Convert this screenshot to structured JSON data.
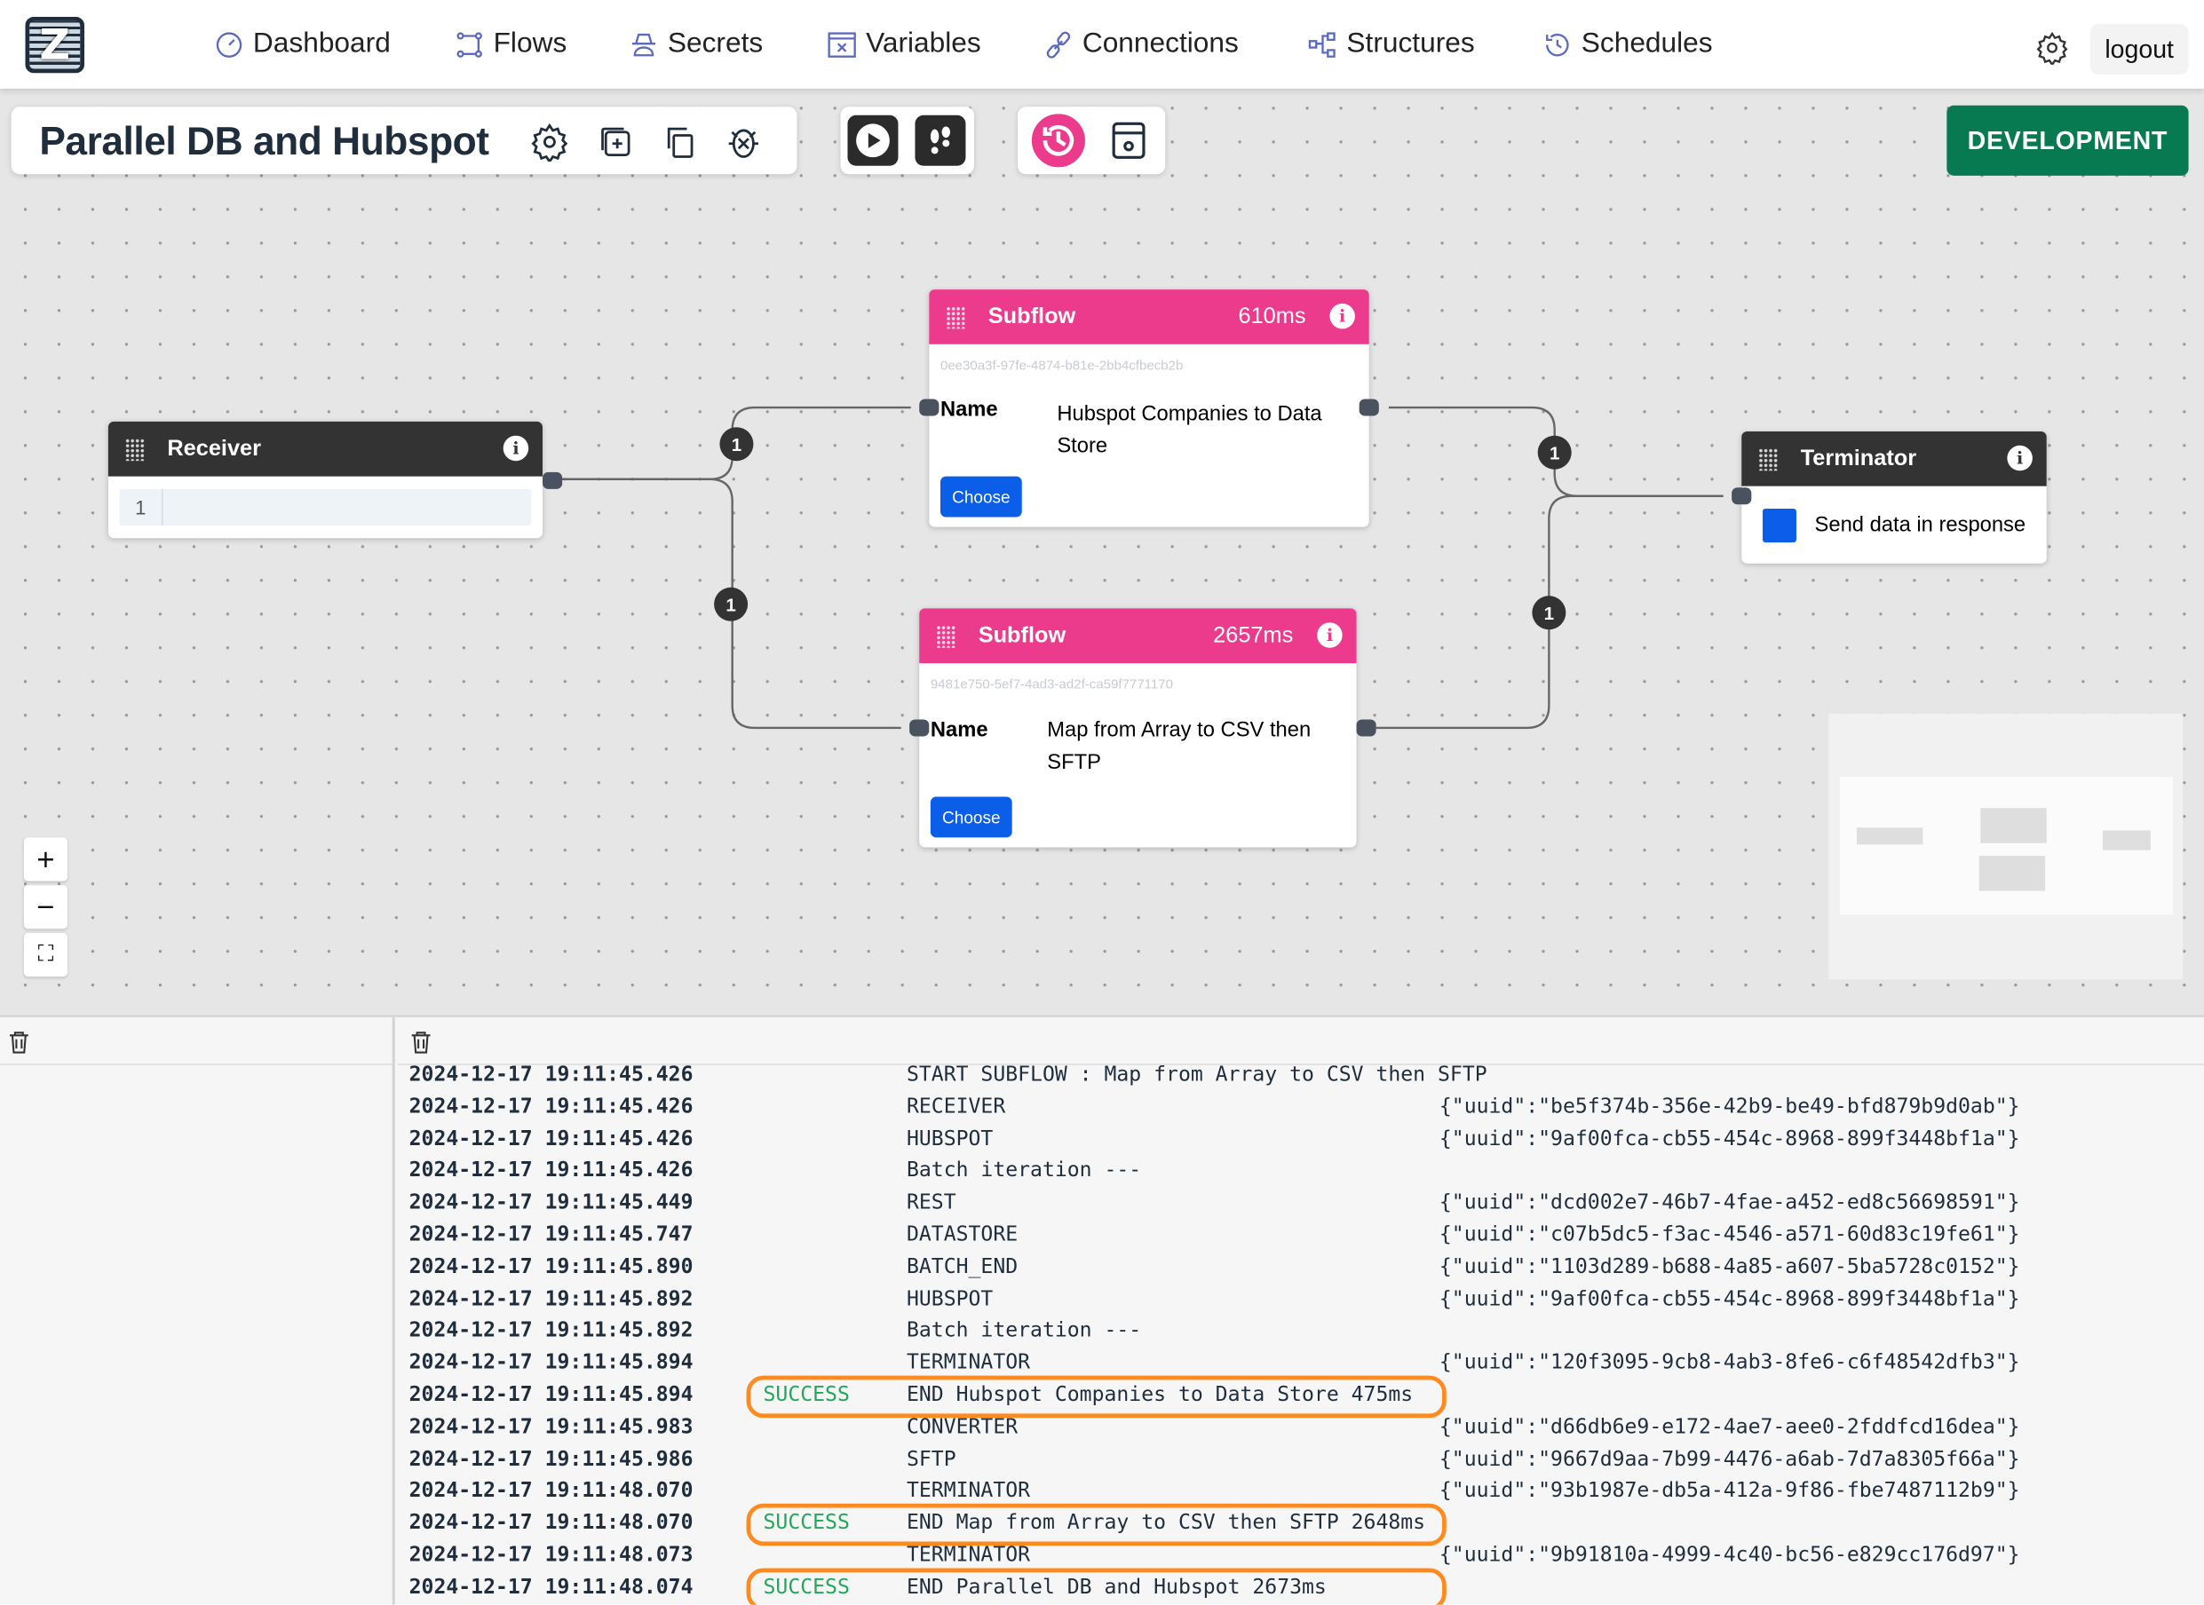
{
  "nav": {
    "logo_letter": "Z",
    "items": [
      {
        "label": "Dashboard",
        "icon": "gauge-icon"
      },
      {
        "label": "Flows",
        "icon": "flow-icon"
      },
      {
        "label": "Secrets",
        "icon": "spy-icon"
      },
      {
        "label": "Variables",
        "icon": "variable-icon"
      },
      {
        "label": "Connections",
        "icon": "link-icon"
      },
      {
        "label": "Structures",
        "icon": "structure-icon"
      },
      {
        "label": "Schedules",
        "icon": "history-icon"
      }
    ],
    "logout_label": "logout"
  },
  "toolbar": {
    "flow_title": "Parallel DB and Hubspot",
    "environment_label": "DEVELOPMENT",
    "colors": {
      "environment": "#087a52",
      "accent": "#ec3a8c"
    }
  },
  "nodes": {
    "receiver": {
      "title": "Receiver",
      "line_number": "1",
      "info": "i"
    },
    "subflow1": {
      "title": "Subflow",
      "duration": "610ms",
      "uuid": "0ee30a3f-97fe-4874-b81e-2bb4cfbecb2b",
      "name_label": "Name",
      "name_value": "Hubspot Companies to Data Store",
      "choose_label": "Choose",
      "info": "i"
    },
    "subflow2": {
      "title": "Subflow",
      "duration": "2657ms",
      "uuid": "9481e750-5ef7-4ad3-ad2f-ca59f7771170",
      "name_label": "Name",
      "name_value": "Map from Array to CSV then SFTP",
      "choose_label": "Choose",
      "info": "i"
    },
    "terminator": {
      "title": "Terminator",
      "label": "Send data in response",
      "info": "i",
      "swatch_color": "#0b5ee8"
    }
  },
  "edges": {
    "badges": [
      "1",
      "1",
      "1",
      "1"
    ]
  },
  "zoom_controls": {
    "zoom_in": "+",
    "zoom_out": "−",
    "fit": "⛶"
  },
  "logs": [
    {
      "ts": "2024-12-17 19:11:45.426",
      "status": "",
      "msg": "START SUBFLOW : Map from Array to CSV then SFTP",
      "data": ""
    },
    {
      "ts": "2024-12-17 19:11:45.426",
      "status": "",
      "msg": "RECEIVER",
      "data": "{\"uuid\":\"be5f374b-356e-42b9-be49-bfd879b9d0ab\"}"
    },
    {
      "ts": "2024-12-17 19:11:45.426",
      "status": "",
      "msg": "HUBSPOT",
      "data": "{\"uuid\":\"9af00fca-cb55-454c-8968-899f3448bf1a\"}"
    },
    {
      "ts": "2024-12-17 19:11:45.426",
      "status": "",
      "msg": "Batch iteration ---",
      "data": ""
    },
    {
      "ts": "2024-12-17 19:11:45.449",
      "status": "",
      "msg": "REST",
      "data": "{\"uuid\":\"dcd002e7-46b7-4fae-a452-ed8c56698591\"}"
    },
    {
      "ts": "2024-12-17 19:11:45.747",
      "status": "",
      "msg": "DATASTORE",
      "data": "{\"uuid\":\"c07b5dc5-f3ac-4546-a571-60d83c19fe61\"}"
    },
    {
      "ts": "2024-12-17 19:11:45.890",
      "status": "",
      "msg": "BATCH_END",
      "data": "{\"uuid\":\"1103d289-b688-4a85-a607-5ba5728c0152\"}"
    },
    {
      "ts": "2024-12-17 19:11:45.892",
      "status": "",
      "msg": "HUBSPOT",
      "data": "{\"uuid\":\"9af00fca-cb55-454c-8968-899f3448bf1a\"}"
    },
    {
      "ts": "2024-12-17 19:11:45.892",
      "status": "",
      "msg": "Batch iteration ---",
      "data": ""
    },
    {
      "ts": "2024-12-17 19:11:45.894",
      "status": "",
      "msg": "TERMINATOR",
      "data": "{\"uuid\":\"120f3095-9cb8-4ab3-8fe6-c6f48542dfb3\"}"
    },
    {
      "ts": "2024-12-17 19:11:45.894",
      "status": "SUCCESS",
      "msg": "END Hubspot Companies to Data Store 475ms",
      "data": "",
      "highlighted": true
    },
    {
      "ts": "2024-12-17 19:11:45.983",
      "status": "",
      "msg": "CONVERTER",
      "data": "{\"uuid\":\"d66db6e9-e172-4ae7-aee0-2fddfcd16dea\"}"
    },
    {
      "ts": "2024-12-17 19:11:45.986",
      "status": "",
      "msg": "SFTP",
      "data": "{\"uuid\":\"9667d9aa-7b99-4476-a6ab-7d7a8305f66a\"}"
    },
    {
      "ts": "2024-12-17 19:11:48.070",
      "status": "",
      "msg": "TERMINATOR",
      "data": "{\"uuid\":\"93b1987e-db5a-412a-9f86-fbe7487112b9\"}"
    },
    {
      "ts": "2024-12-17 19:11:48.070",
      "status": "SUCCESS",
      "msg": "END Map from Array to CSV then SFTP 2648ms",
      "data": "",
      "highlighted": true
    },
    {
      "ts": "2024-12-17 19:11:48.073",
      "status": "",
      "msg": "TERMINATOR",
      "data": "{\"uuid\":\"9b91810a-4999-4c40-bc56-e829cc176d97\"}"
    },
    {
      "ts": "2024-12-17 19:11:48.074",
      "status": "SUCCESS",
      "msg": "END Parallel DB and Hubspot 2673ms",
      "data": "",
      "highlighted": true
    }
  ]
}
